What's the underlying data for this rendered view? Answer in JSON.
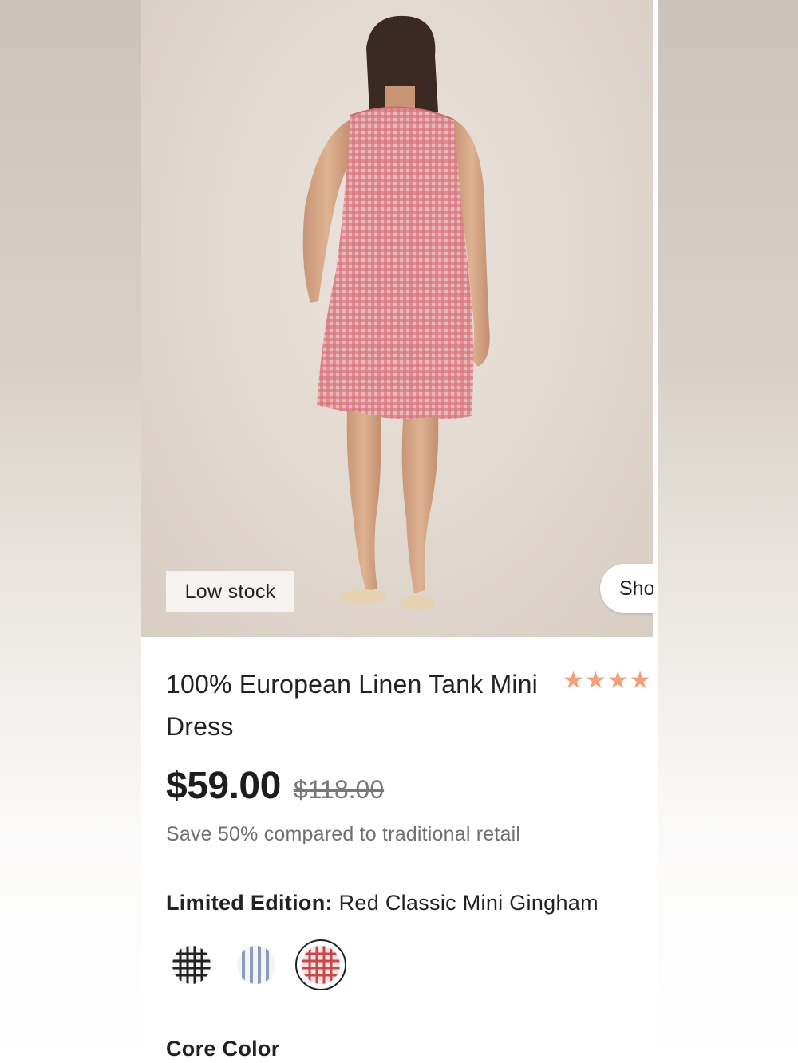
{
  "product": {
    "badge": "Low stock",
    "shop_button_label": "Sho",
    "title": "100% European Linen Tank Mini Dress",
    "rating_stars": "★★★★",
    "price": "$59.00",
    "original_price": "$118.00",
    "savings_text": "Save 50% compared to traditional retail",
    "edition_label": "Limited Edition:",
    "edition_value": " Red Classic Mini Gingham",
    "section_core_color": "Core Color"
  },
  "swatches": [
    {
      "icon": "black-gingham-swatch-icon",
      "color": "#2a2a2a",
      "selected": false
    },
    {
      "icon": "blue-stripe-swatch-icon",
      "color": "#8e9bb8",
      "selected": false
    },
    {
      "icon": "red-gingham-swatch-icon",
      "color": "#c8474a",
      "selected": true
    }
  ],
  "colors": {
    "star": "#f0a07a",
    "dress": "#d88f94",
    "background": "#e3dad1"
  }
}
